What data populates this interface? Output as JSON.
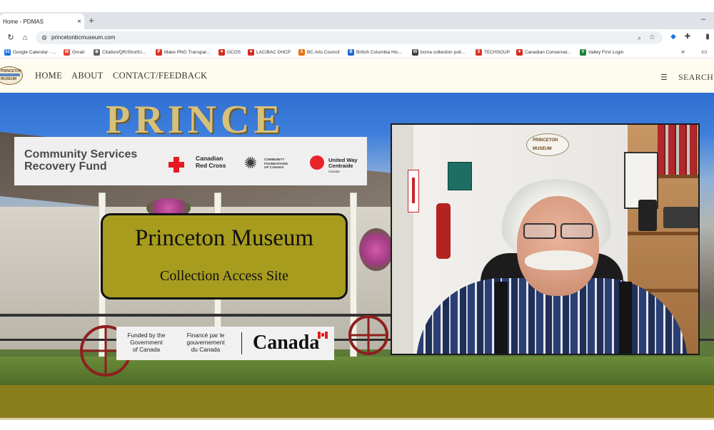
{
  "browser": {
    "tab_title": "Home - PDMAS",
    "tab_close": "×",
    "new_tab": "+",
    "minimize": "–",
    "url": "princetonbcmuseum.com",
    "bookmarks_more": "»",
    "bookmarks": [
      {
        "label": "Google Calendar - ...",
        "color": "#1a73e8",
        "glyph": "31"
      },
      {
        "label": "Gmail",
        "color": "#ea4335",
        "glyph": "M"
      },
      {
        "label": "Citation/QR/ShortU...",
        "color": "#5f6368",
        "glyph": "⊕"
      },
      {
        "label": "Make PNG Transpar...",
        "color": "#d93025",
        "glyph": "P"
      },
      {
        "label": "GCOS",
        "color": "#d52b1e",
        "glyph": "✦"
      },
      {
        "label": "LAC/BAC DHCP",
        "color": "#d52b1e",
        "glyph": "✦"
      },
      {
        "label": "BC Arts Council",
        "color": "#e8710a",
        "glyph": "A"
      },
      {
        "label": "British Columbia His...",
        "color": "#1967d2",
        "glyph": "B"
      },
      {
        "label": "bcma collection poli...",
        "color": "#3c4043",
        "glyph": "W"
      },
      {
        "label": "TECHSOUP",
        "color": "#d93025",
        "glyph": "S"
      },
      {
        "label": "Canadian Conservat...",
        "color": "#d52b1e",
        "glyph": "✦"
      },
      {
        "label": "Valley First Login",
        "color": "#188038",
        "glyph": "V"
      }
    ]
  },
  "site": {
    "logo_top": "PRINCETON",
    "logo_bottom": "MUSEUM",
    "nav": [
      "HOME",
      "ABOUT",
      "CONTACT/FEEDBACK"
    ],
    "search": "SEARCH",
    "building_sign": "PRINCE"
  },
  "banner": {
    "csrf_line1": "Community Services",
    "csrf_line2": "Recovery Fund",
    "red_cross_1": "Canadian",
    "red_cross_2": "Red Cross",
    "cfc_1": "COMMUNITY",
    "cfc_2": "FOUNDATIONS",
    "cfc_3": "OF CANADA",
    "uw_1": "United Way",
    "uw_2": "Centraide",
    "uw_3": "Canada"
  },
  "museum": {
    "title": "Princeton Museum",
    "subtitle": "Collection Access Site"
  },
  "funding": {
    "en_1": "Funded by the",
    "en_2": "Government",
    "en_3": "of Canada",
    "fr_1": "Financé par le",
    "fr_2": "gouvernement",
    "fr_3": "du Canada",
    "canada": "Canada"
  },
  "video": {
    "plaque_top": "PRINCETON",
    "plaque_bottom": "MUSEUM"
  },
  "icons": {
    "reload": "↻",
    "home": "⌂",
    "tune": "⚙",
    "zoom": "⌕",
    "star": "☆",
    "menu": "☰",
    "folder": "▭"
  }
}
